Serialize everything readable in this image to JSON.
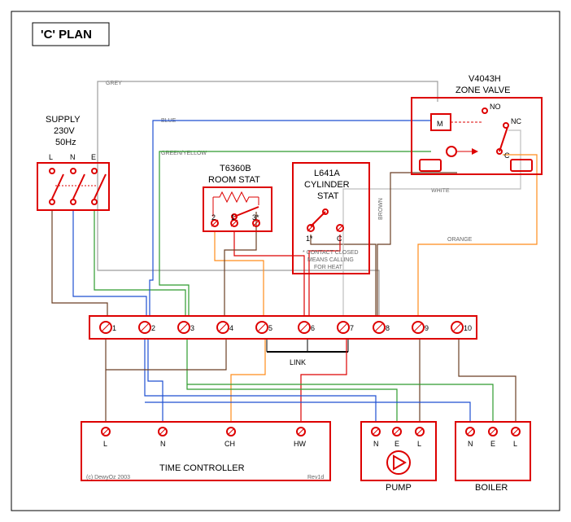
{
  "title": "'C' PLAN",
  "supply": {
    "label": "SUPPLY",
    "voltage": "230V",
    "freq": "50Hz",
    "L": "L",
    "N": "N",
    "E": "E"
  },
  "roomstat": {
    "model": "T6360B",
    "label": "ROOM STAT",
    "t1": "1",
    "t2": "2",
    "t3": "3*"
  },
  "cylstat": {
    "model": "L641A",
    "label1": "CYLINDER",
    "label2": "STAT",
    "t1": "1*",
    "tC": "C",
    "note1": "* CONTACT CLOSED",
    "note2": "MEANS CALLING",
    "note3": "FOR HEAT"
  },
  "zone": {
    "model": "V4043H",
    "label": "ZONE VALVE",
    "M": "M",
    "NO": "NO",
    "NC": "NC",
    "C": "C"
  },
  "terminals": {
    "1": "1",
    "2": "2",
    "3": "3",
    "4": "4",
    "5": "5",
    "6": "6",
    "7": "7",
    "8": "8",
    "9": "9",
    "10": "10",
    "link": "LINK"
  },
  "controller": {
    "label": "TIME CONTROLLER",
    "L": "L",
    "N": "N",
    "CH": "CH",
    "HW": "HW",
    "copy": "(c) DewyOz 2003",
    "rev": "Rev1d"
  },
  "pump": {
    "label": "PUMP",
    "N": "N",
    "E": "E",
    "L": "L"
  },
  "boiler": {
    "label": "BOILER",
    "N": "N",
    "E": "E",
    "L": "L"
  },
  "wires": {
    "grey": "GREY",
    "blue": "BLUE",
    "greenyellow": "GREEN/YELLOW",
    "brown": "BROWN",
    "white": "WHITE",
    "orange": "ORANGE"
  }
}
